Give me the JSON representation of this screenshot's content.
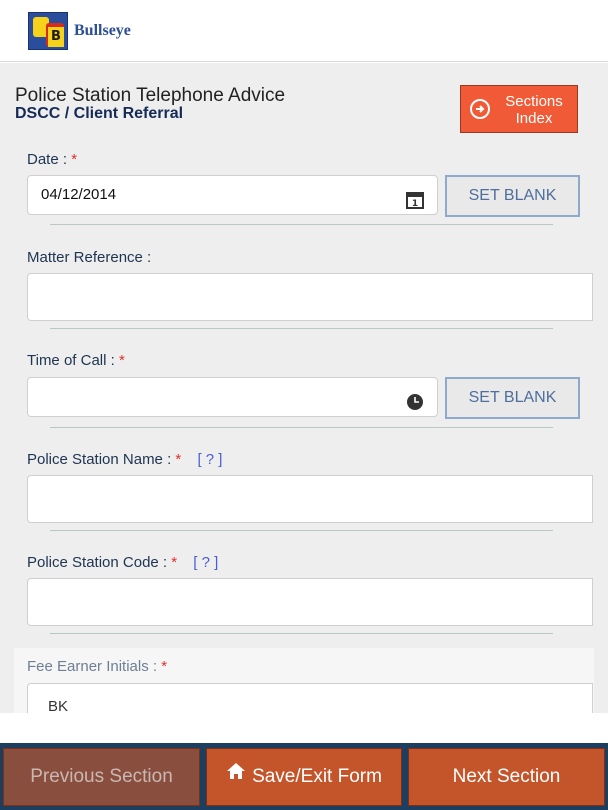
{
  "header": {
    "app_name": "Bullseye",
    "logo_letter": "B"
  },
  "form": {
    "title": "Police Station Telephone Advice",
    "subtitle": "DSCC / Client Referral",
    "sections_button": "Sections Index",
    "required_marker": "*",
    "fields": {
      "date": {
        "label": "Date :",
        "value": "04/12/2014",
        "action": "SET BLANK"
      },
      "matter_reference": {
        "label": "Matter Reference :",
        "value": ""
      },
      "time_of_call": {
        "label": "Time of Call :",
        "value": "",
        "action": "SET BLANK"
      },
      "police_station_name": {
        "label": "Police Station Name :",
        "help": "[ ? ]",
        "value": ""
      },
      "police_station_code": {
        "label": "Police Station Code :",
        "help": "[ ? ]",
        "value": ""
      },
      "fee_earner_initials": {
        "label": "Fee Earner Initials :",
        "value": "BK"
      }
    }
  },
  "footer": {
    "previous": "Previous Section",
    "save_exit": "Save/Exit Form",
    "next": "Next Section"
  },
  "colors": {
    "accent_orange": "#f15a36",
    "footer_navy": "#1c3f5f",
    "button_rust": "#c4552b",
    "required_red": "#e0302a",
    "label_navy": "#1e3451"
  },
  "icons": {
    "sections": "circle-arrow-right-icon",
    "date": "calendar-icon",
    "time": "clock-icon",
    "save": "home-icon"
  }
}
